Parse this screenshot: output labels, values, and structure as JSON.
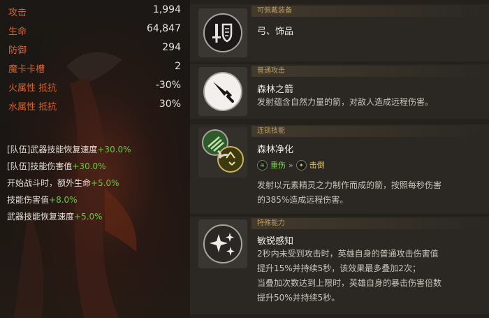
{
  "stats": [
    {
      "label": "攻击",
      "value": "1,994"
    },
    {
      "label": "生命",
      "value": "64,847"
    },
    {
      "label": "防御",
      "value": "294"
    },
    {
      "label": "魔卡卡槽",
      "value": "2"
    },
    {
      "label": "火属性 抵抗",
      "value": "-30%"
    },
    {
      "label": "水属性 抵抗",
      "value": "30%"
    }
  ],
  "bonuses": [
    {
      "text": "[队伍]武器技能恢复速度",
      "value": "+30.0%"
    },
    {
      "text": "[队伍]技能伤害值",
      "value": "+30.0%"
    },
    {
      "text": "开始战斗时，额外生命",
      "value": "+5.0%"
    },
    {
      "text": "技能伤害值",
      "value": "+8.0%"
    },
    {
      "text": "武器技能恢复速度",
      "value": "+5.0%"
    }
  ],
  "equipable": {
    "tag": "可佩戴装备",
    "text": "弓、饰品",
    "icon": "sword-shield-icon"
  },
  "normal_attack": {
    "tag": "普通攻击",
    "title": "森林之箭",
    "desc": "发射蕴含自然力量的箭，对敌人造成远程伤害。",
    "icon": "dagger-icon"
  },
  "chain_skill": {
    "tag": "连锁技能",
    "title": "森林净化",
    "from": "重伤",
    "arrow": "»",
    "to": "击倒",
    "desc_line1": "发射以元素精灵之力制作而成的箭，按照每秒伤害",
    "desc_line2": "的385%造成远程伤害。",
    "icon": "chain-arrows-icon"
  },
  "special": {
    "tag": "特殊能力",
    "title": "敏锐感知",
    "lines": [
      "2秒内未受到攻击时，英雄自身的普通攻击伤害值",
      "提升15%并持续5秒，该效果最多叠加2次；",
      "当叠加次数达到上限时，英雄自身的暴击伤害倍数",
      "提升50%并持续5秒。"
    ],
    "icon": "sparkles-icon"
  },
  "colors": {
    "stat_label": "#d8622c",
    "bonus_value": "#5fcf3a",
    "tag_text": "#b79a62"
  }
}
